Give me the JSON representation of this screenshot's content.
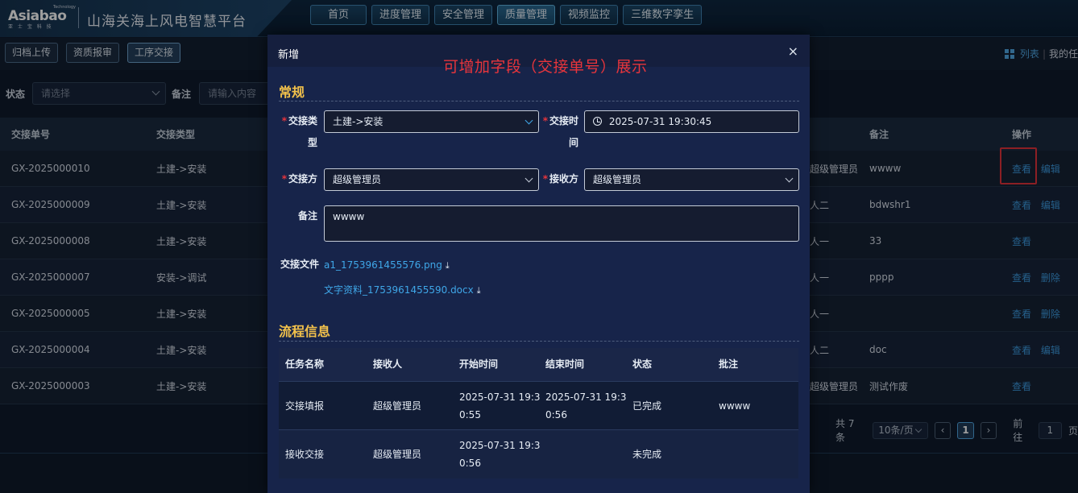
{
  "header": {
    "logo_text": "Asiabao",
    "logo_sub": "亚 士 宝 科 技",
    "logo_tag": "Technology",
    "app_title": "山海关海上风电智慧平台",
    "nav": [
      "首页",
      "进度管理",
      "安全管理",
      "质量管理",
      "视频监控",
      "三维数字孪生"
    ],
    "active_nav": "质量管理"
  },
  "subbar": {
    "buttons": [
      "归档上传",
      "资质报审",
      "工序交接"
    ],
    "active": "工序交接",
    "view_list": "列表",
    "view_sep": "|",
    "view_my": "我的任"
  },
  "filters": {
    "status_label": "状态",
    "status_placeholder": "请选择",
    "note_label": "备注",
    "note_placeholder": "请输入内容"
  },
  "table": {
    "headers": {
      "no": "交接单号",
      "type": "交接类型",
      "note": "备注",
      "ops": "操作"
    },
    "rows": [
      {
        "no": "GX-2025000010",
        "type": "土建->安装",
        "user": "超级管理员",
        "note": "wwww",
        "ops": [
          "查看",
          "编辑"
        ]
      },
      {
        "no": "GX-2025000009",
        "type": "土建->安装",
        "user": "人二",
        "note": "bdwshr1",
        "ops": [
          "查看",
          "编辑"
        ]
      },
      {
        "no": "GX-2025000008",
        "type": "土建->安装",
        "user": "人一",
        "note": "33",
        "ops": [
          "查看"
        ]
      },
      {
        "no": "GX-2025000007",
        "type": "安装->调试",
        "user": "人一",
        "note": "pppp",
        "ops": [
          "查看",
          "删除"
        ]
      },
      {
        "no": "GX-2025000005",
        "type": "土建->安装",
        "user": "人一",
        "note": "",
        "ops": [
          "查看",
          "删除"
        ]
      },
      {
        "no": "GX-2025000004",
        "type": "土建->安装",
        "user": "人二",
        "note": "doc",
        "ops": [
          "查看",
          "编辑"
        ]
      },
      {
        "no": "GX-2025000003",
        "type": "土建->安装",
        "user": "超级管理员",
        "note": "测试作废",
        "ops": [
          "查看"
        ]
      }
    ]
  },
  "pagination": {
    "total": "共 7 条",
    "page_size": "10条/页",
    "current": "1",
    "goto_label": "前往",
    "goto_value": "1",
    "goto_suffix": "页"
  },
  "modal": {
    "title": "新增",
    "close": "×",
    "annotation": "可增加字段（交接单号）展示",
    "section_general": "常规",
    "fields": {
      "type_label_1": "交接类",
      "type_label_2": "型",
      "type_value": "土建->安装",
      "time_label_1": "交接时",
      "time_label_2": "间",
      "time_value": "2025-07-31 19:30:45",
      "from_label": "交接方",
      "from_value": "超级管理员",
      "to_label": "接收方",
      "to_value": "超级管理员",
      "note_label": "备注",
      "note_value": "wwww",
      "files_label": "交接文件",
      "files": [
        "a1_1753961455576.png",
        "文字资料_1753961455590.docx"
      ]
    },
    "section_flow": "流程信息",
    "flow": {
      "headers": [
        "任务名称",
        "接收人",
        "开始时间",
        "结束时间",
        "状态",
        "批注"
      ],
      "rows": [
        {
          "task": "交接填报",
          "receiver": "超级管理员",
          "start_1": "2025-07-31 19:3",
          "start_2": "0:55",
          "end_1": "2025-07-31 19:3",
          "end_2": "0:56",
          "status": "已完成",
          "note": "wwww"
        },
        {
          "task": "接收交接",
          "receiver": "超级管理员",
          "start_1": "2025-07-31 19:3",
          "start_2": "0:56",
          "end_1": "",
          "end_2": "",
          "status": "未完成",
          "note": ""
        }
      ]
    }
  }
}
